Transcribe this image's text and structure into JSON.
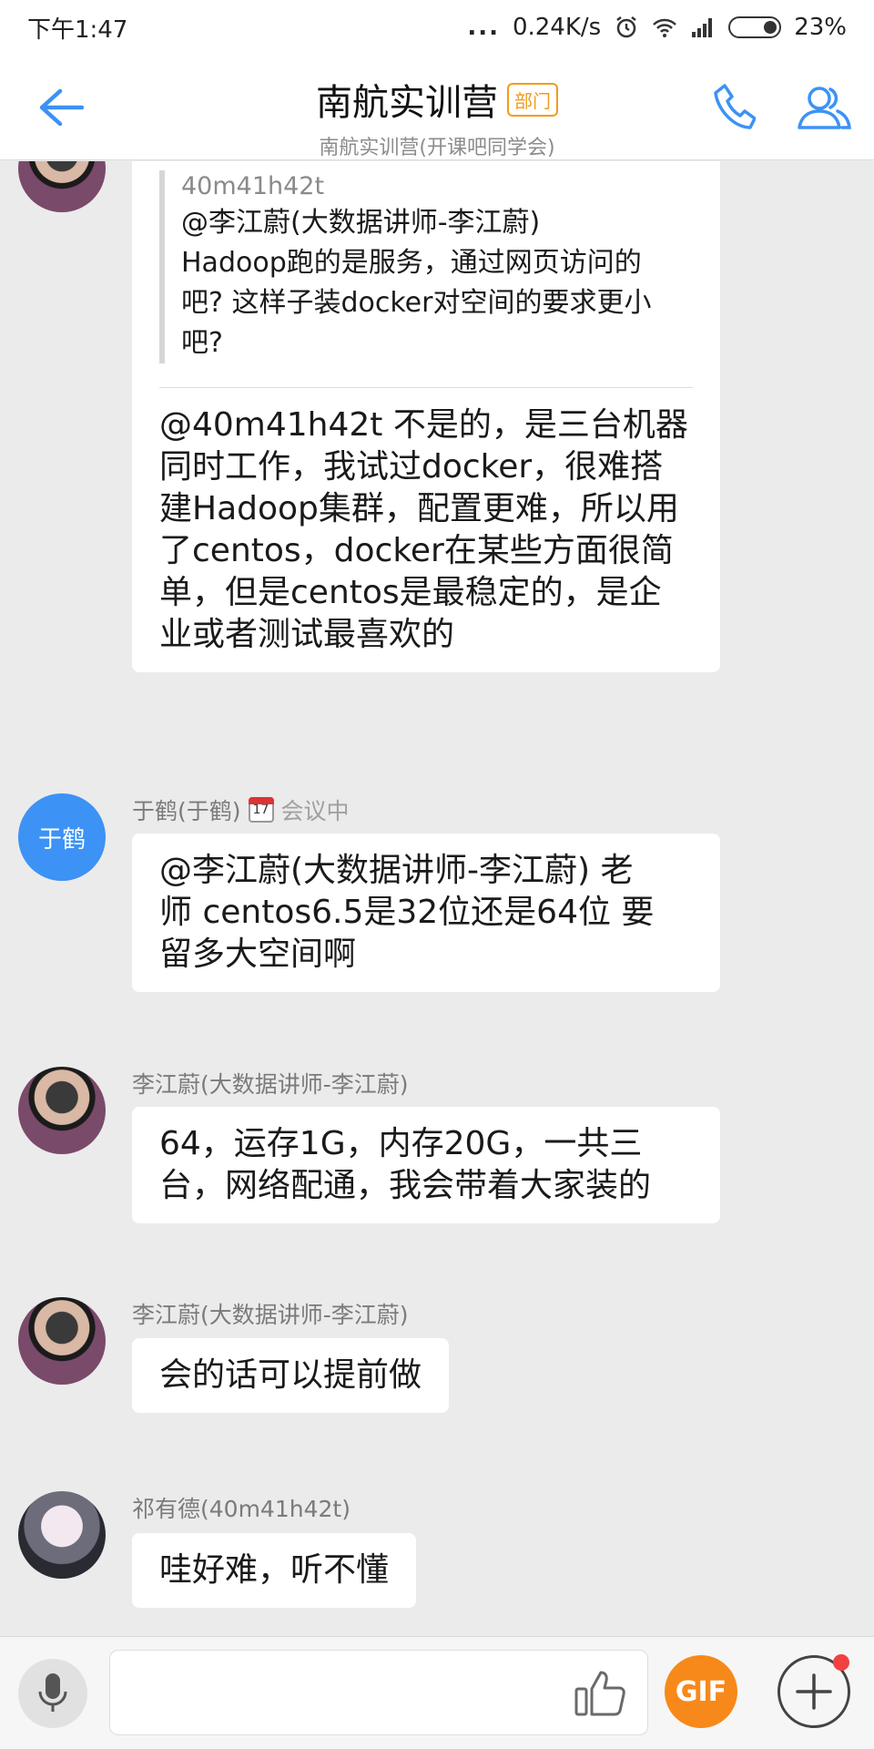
{
  "status_bar": {
    "time": "下午1:47",
    "dots": "...",
    "net_speed": "0.24K/s",
    "battery": "23%"
  },
  "header": {
    "title": "南航实训营",
    "badge": "部门",
    "subtitle": "南航实训营(开课吧同学会)"
  },
  "messages": [
    {
      "quote": {
        "author": "40m41h42t",
        "lines": [
          "@李江蔚(大数据讲师-李江蔚)",
          "Hadoop跑的是服务，通过网页访问的",
          "吧? 这样子装docker对空间的要求更小",
          "吧?"
        ]
      },
      "lines": [
        "@40m41h42t 不是的，是三台机器",
        "同时工作，我试过docker，很难搭",
        "建Hadoop集群，配置更难，所以用",
        "了centos，docker在某些方面很简",
        "单，但是centos是最稳定的，是企",
        "业或者测试最喜欢的"
      ]
    },
    {
      "sender": "于鹤(于鹤)",
      "avatar_text": "于鹤",
      "calendar_day": "17",
      "status": "会议中",
      "lines": [
        "@李江蔚(大数据讲师-李江蔚) 老",
        "师 centos6.5是32位还是64位 要",
        "留多大空间啊"
      ]
    },
    {
      "sender": "李江蔚(大数据讲师-李江蔚)",
      "lines": [
        "64，运存1G，内存20G，一共三",
        "台，网络配通，我会带着大家装的"
      ]
    },
    {
      "sender": "李江蔚(大数据讲师-李江蔚)",
      "lines": [
        "会的话可以提前做"
      ]
    },
    {
      "sender": "祁有德(40m41h42t)",
      "lines": [
        "哇好难，听不懂"
      ]
    }
  ],
  "input_bar": {
    "gif_label": "GIF",
    "input_value": ""
  },
  "colors": {
    "accent_blue": "#3c92f5",
    "badge_orange": "#f29b18",
    "gif_orange": "#f7891a",
    "chat_background": "#ebebeb"
  },
  "icons": [
    "back-arrow-icon",
    "phone-icon",
    "group-members-icon",
    "microphone-icon",
    "thumbs-up-icon",
    "plus-icon",
    "alarm-icon",
    "wifi-icon",
    "signal-icon",
    "calendar-icon"
  ]
}
